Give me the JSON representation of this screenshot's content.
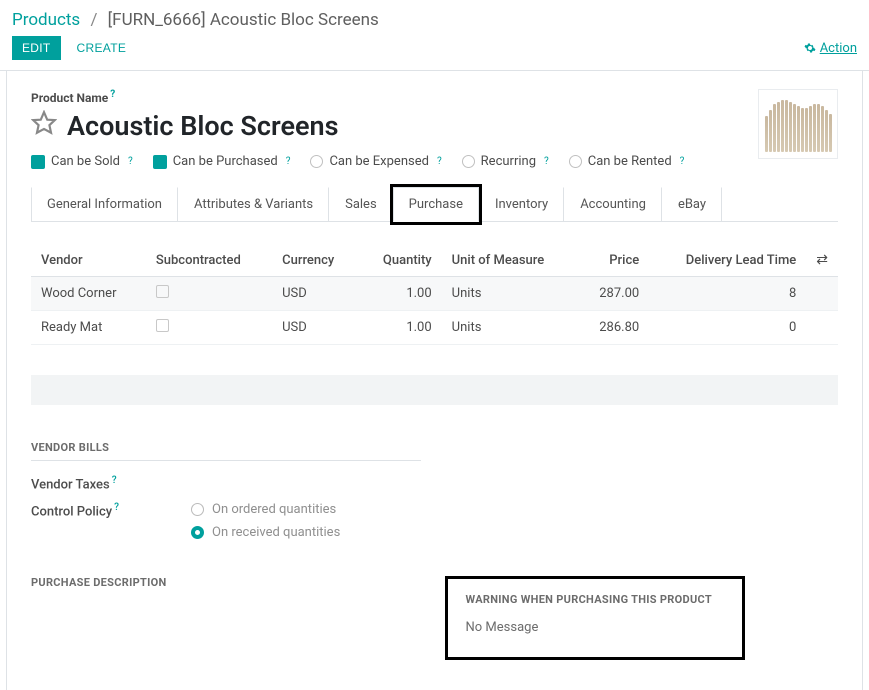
{
  "breadcrumb": {
    "root": "Products",
    "current": "[FURN_6666] Acoustic Bloc Screens"
  },
  "toolbar": {
    "edit": "Edit",
    "create": "Create",
    "action": "Action"
  },
  "product": {
    "name_label": "Product Name",
    "name": "Acoustic Bloc Screens"
  },
  "options": {
    "can_sold": "Can be Sold",
    "can_purchased": "Can be Purchased",
    "can_expensed": "Can be Expensed",
    "recurring": "Recurring",
    "can_rented": "Can be Rented"
  },
  "tabs": [
    "General Information",
    "Attributes & Variants",
    "Sales",
    "Purchase",
    "Inventory",
    "Accounting",
    "eBay"
  ],
  "vendor_table": {
    "headers": {
      "vendor": "Vendor",
      "sub": "Subcontracted",
      "currency": "Currency",
      "qty": "Quantity",
      "uom": "Unit of Measure",
      "price": "Price",
      "lead": "Delivery Lead Time"
    },
    "rows": [
      {
        "vendor": "Wood Corner",
        "currency": "USD",
        "qty": "1.00",
        "uom": "Units",
        "price": "287.00",
        "lead": "8"
      },
      {
        "vendor": "Ready Mat",
        "currency": "USD",
        "qty": "1.00",
        "uom": "Units",
        "price": "286.80",
        "lead": "0"
      }
    ]
  },
  "sections": {
    "vendor_bills": "VENDOR BILLS",
    "vendor_taxes": "Vendor Taxes",
    "control_policy": "Control Policy",
    "on_ordered": "On ordered quantities",
    "on_received": "On received quantities",
    "purchase_desc": "PURCHASE DESCRIPTION",
    "warning_title": "WARNING WHEN PURCHASING THIS PRODUCT",
    "warning_value": "No Message"
  }
}
